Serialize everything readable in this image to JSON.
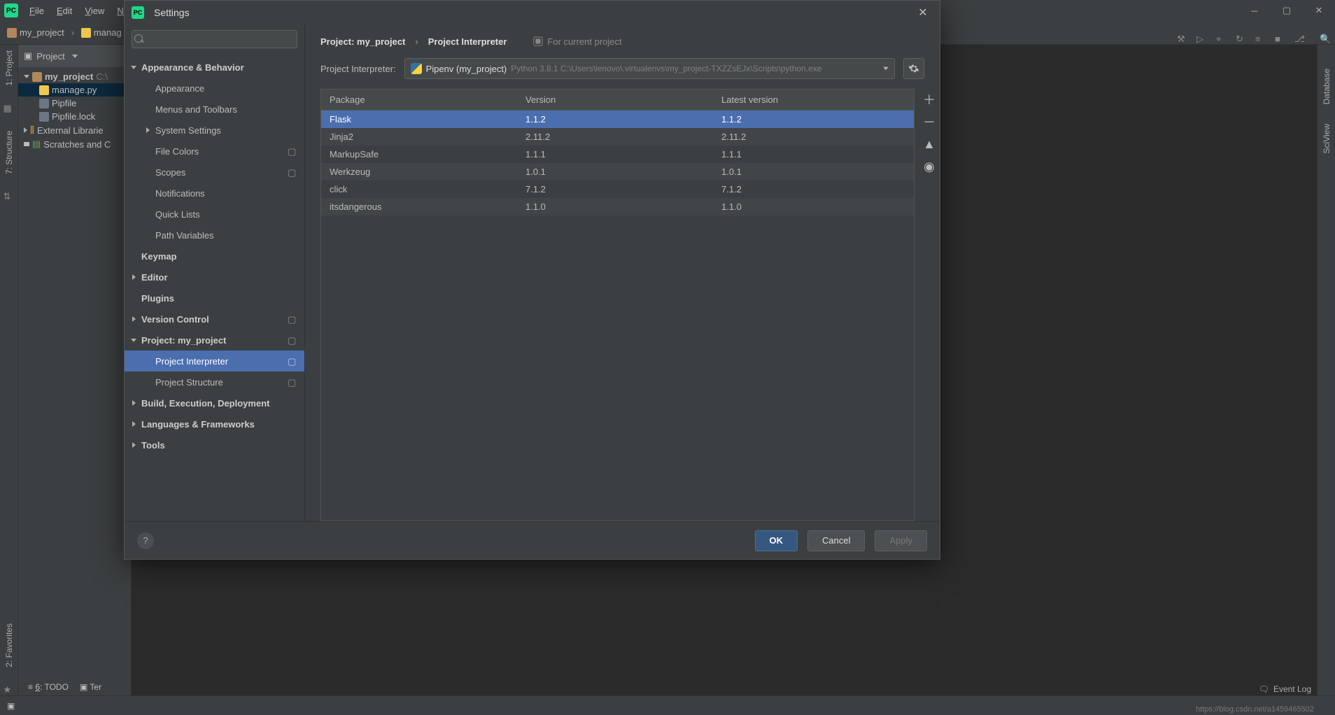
{
  "menubar": {
    "file": "File",
    "edit": "Edit",
    "view": "View",
    "nav": "N"
  },
  "nav": {
    "crumb1": "my_project",
    "crumb2": "manag"
  },
  "left_tabs": {
    "project": "1: Project",
    "structure": "7: Structure",
    "favorites": "2: Favorites"
  },
  "right_tabs": {
    "database": "Database",
    "sciview": "SciView"
  },
  "project_panel": {
    "title": "Project",
    "root": "my_project",
    "root_hint": "C:\\",
    "files": {
      "manage": "manage.py",
      "pipfile": "Pipfile",
      "pipfilelock": "Pipfile.lock"
    },
    "ext": "External Librarie",
    "scratches": "Scratches and C"
  },
  "bottom_tools": {
    "todo": "6: TODO",
    "terminal": "Terminal"
  },
  "status": {
    "event_log": "Event Log"
  },
  "watermark": "https://blog.csdn.net/a1459465502",
  "dialog": {
    "title": "Settings",
    "search_placeholder": "",
    "breadcrumb": {
      "root": "Project: my_project",
      "leaf": "Project Interpreter",
      "hint": "For current project"
    },
    "tree": {
      "appearance_behavior": "Appearance & Behavior",
      "appearance": "Appearance",
      "menus_toolbars": "Menus and Toolbars",
      "system_settings": "System Settings",
      "file_colors": "File Colors",
      "scopes": "Scopes",
      "notifications": "Notifications",
      "quick_lists": "Quick Lists",
      "path_variables": "Path Variables",
      "keymap": "Keymap",
      "editor": "Editor",
      "plugins": "Plugins",
      "version_control": "Version Control",
      "project": "Project: my_project",
      "project_interpreter": "Project Interpreter",
      "project_structure": "Project Structure",
      "build": "Build, Execution, Deployment",
      "languages": "Languages & Frameworks",
      "tools": "Tools"
    },
    "interpreter": {
      "label": "Project Interpreter:",
      "name": "Pipenv (my_project)",
      "path": "Python 3.8.1 C:\\Users\\lenovo\\.virtualenvs\\my_project-TXZZsEJx\\Scripts\\python.exe"
    },
    "table": {
      "headers": {
        "package": "Package",
        "version": "Version",
        "latest": "Latest version"
      },
      "rows": [
        {
          "pkg": "Flask",
          "ver": "1.1.2",
          "latest": "1.1.2",
          "sel": true
        },
        {
          "pkg": "Jinja2",
          "ver": "2.11.2",
          "latest": "2.11.2"
        },
        {
          "pkg": "MarkupSafe",
          "ver": "1.1.1",
          "latest": "1.1.1"
        },
        {
          "pkg": "Werkzeug",
          "ver": "1.0.1",
          "latest": "1.0.1"
        },
        {
          "pkg": "click",
          "ver": "7.1.2",
          "latest": "7.1.2"
        },
        {
          "pkg": "itsdangerous",
          "ver": "1.1.0",
          "latest": "1.1.0"
        }
      ]
    },
    "buttons": {
      "ok": "OK",
      "cancel": "Cancel",
      "apply": "Apply"
    }
  }
}
